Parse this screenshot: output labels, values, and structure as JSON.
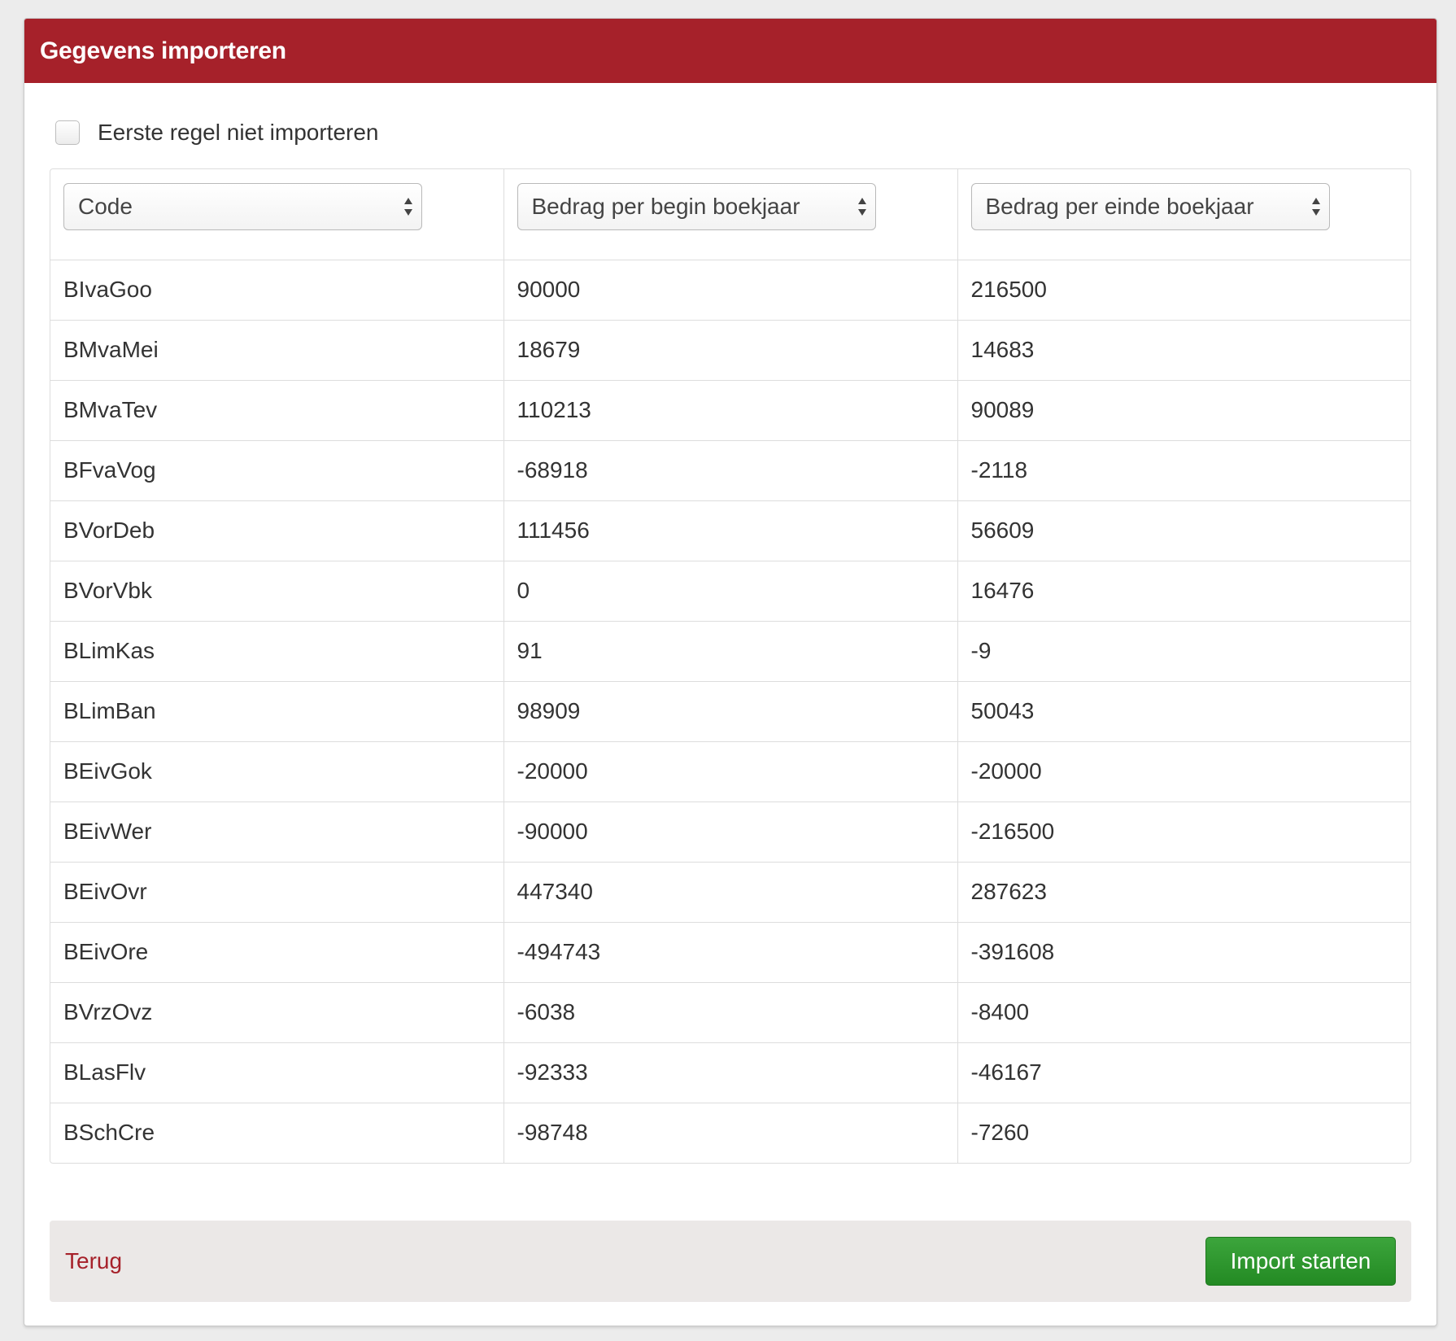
{
  "panel": {
    "title": "Gegevens importeren"
  },
  "options": {
    "skip_first_row_label": "Eerste regel niet importeren",
    "skip_first_row_checked": false
  },
  "columns": [
    {
      "selected": "Code"
    },
    {
      "selected": "Bedrag per begin boekjaar"
    },
    {
      "selected": "Bedrag per einde boekjaar"
    }
  ],
  "rows": [
    [
      "BIvaGoo",
      "90000",
      "216500"
    ],
    [
      "BMvaMei",
      "18679",
      "14683"
    ],
    [
      "BMvaTev",
      "110213",
      "90089"
    ],
    [
      "BFvaVog",
      "-68918",
      "-2118"
    ],
    [
      "BVorDeb",
      "111456",
      "56609"
    ],
    [
      "BVorVbk",
      "0",
      "16476"
    ],
    [
      "BLimKas",
      "91",
      "-9"
    ],
    [
      "BLimBan",
      "98909",
      "50043"
    ],
    [
      "BEivGok",
      "-20000",
      "-20000"
    ],
    [
      "BEivWer",
      "-90000",
      "-216500"
    ],
    [
      "BEivOvr",
      "447340",
      "287623"
    ],
    [
      "BEivOre",
      "-494743",
      "-391608"
    ],
    [
      "BVrzOvz",
      "-6038",
      "-8400"
    ],
    [
      "BLasFlv",
      "-92333",
      "-46167"
    ],
    [
      "BSchCre",
      "-98748",
      "-7260"
    ]
  ],
  "footer": {
    "back_label": "Terug",
    "import_label": "Import starten"
  },
  "colors": {
    "brand": "#a6212a",
    "primary_button": "#2e962e",
    "footer_bg": "#ebe8e7"
  },
  "icons": {
    "select": "select-arrows-icon"
  }
}
